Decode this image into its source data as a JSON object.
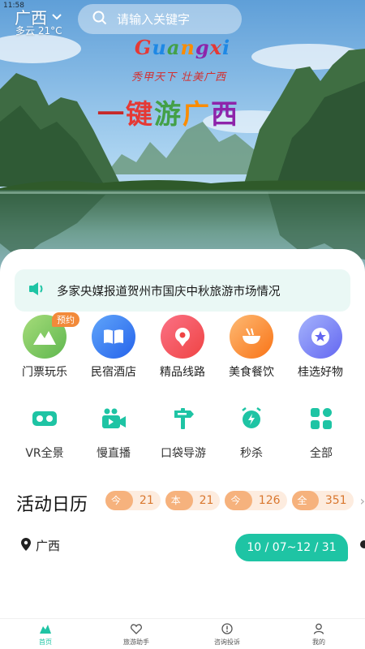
{
  "status_bar": {
    "time_stub": "11:58"
  },
  "header": {
    "city": "广西",
    "weather": "多云 21°C",
    "search_placeholder": "请输入关键字"
  },
  "banner": {
    "logo_text": "Guangxi",
    "logo_slogan": "秀甲天下 壮美广西",
    "headline": [
      "一",
      "键",
      "游",
      "广",
      "西"
    ]
  },
  "notice": {
    "text": "多家央媒报道贺州市国庆中秋旅游市场情况"
  },
  "categories": [
    {
      "label": "门票玩乐",
      "badge": "预约",
      "icon": "mountain-icon",
      "color": "#7bc96f"
    },
    {
      "label": "民宿酒店",
      "icon": "book-icon",
      "color": "#3b82f6"
    },
    {
      "label": "精品线路",
      "icon": "map-pin-icon",
      "color": "#ef4444"
    },
    {
      "label": "美食餐饮",
      "icon": "noodle-bowl-icon",
      "color": "#f97316"
    },
    {
      "label": "桂选好物",
      "icon": "badge-star-icon",
      "color": "#6366f1"
    }
  ],
  "utilities": [
    {
      "label": "VR全景",
      "icon": "vr-goggles-icon"
    },
    {
      "label": "慢直播",
      "icon": "video-camera-icon"
    },
    {
      "label": "口袋导游",
      "icon": "signpost-icon"
    },
    {
      "label": "秒杀",
      "icon": "alarm-clock-icon"
    },
    {
      "label": "全部",
      "icon": "grid-icon"
    }
  ],
  "activity": {
    "title": "活动日历",
    "stats": [
      {
        "key": "今日",
        "value": "21"
      },
      {
        "key": "本月",
        "value": "21"
      },
      {
        "key": "今年",
        "value": "126"
      },
      {
        "key": "全部",
        "value": "351"
      }
    ],
    "more": "›",
    "location": "广西",
    "date_range": "10 / 07~12 / 31"
  },
  "tabs": [
    {
      "label": "首页",
      "icon": "home-icon",
      "active": true
    },
    {
      "label": "旅游助手",
      "icon": "heart-icon",
      "active": false
    },
    {
      "label": "咨询投诉",
      "icon": "alert-bubble-icon",
      "active": false
    },
    {
      "label": "我的",
      "icon": "user-icon",
      "active": false
    }
  ],
  "colors": {
    "accent": "#1ec4a4",
    "stat_text": "#d9772e",
    "stat_key_bg": "#f6b27d"
  }
}
